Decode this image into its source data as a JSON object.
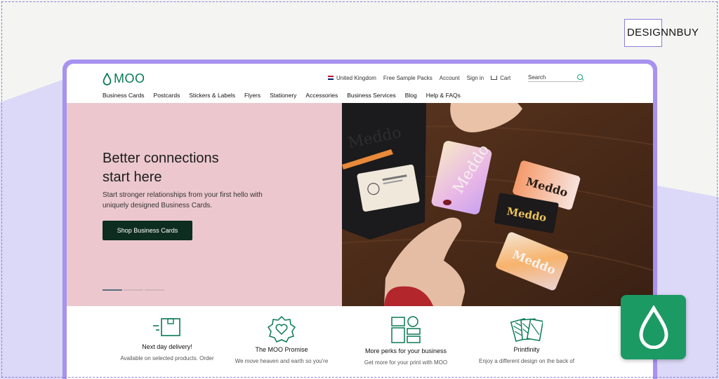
{
  "brand_badge": {
    "text": "DESIGNNBUY"
  },
  "site": {
    "logo_text": "MOO",
    "utility": {
      "region": "United Kingdom",
      "sample_packs": "Free Sample Packs",
      "account": "Account",
      "sign_in": "Sign in",
      "cart": "Cart",
      "search_label": "Search"
    },
    "nav": [
      "Business Cards",
      "Postcards",
      "Stickers & Labels",
      "Flyers",
      "Stationery",
      "Accessories",
      "Business Services",
      "Blog",
      "Help & FAQs"
    ],
    "hero": {
      "title_line1": "Better connections",
      "title_line2": "start here",
      "subtitle": "Start stronger relationships from your first hello with uniquely designed Business Cards.",
      "cta": "Shop Business Cards",
      "slide_active": 1,
      "slide_count": 3,
      "card_text": "Meddo"
    },
    "features": [
      {
        "title": "Next day delivery!",
        "desc": "Available on selected products. Order",
        "icon": "delivery-box-icon"
      },
      {
        "title": "The MOO Promise",
        "desc": "We move heaven and earth so you're",
        "icon": "heart-badge-icon"
      },
      {
        "title": "More perks for your business",
        "desc": "Get more for your print with MOO",
        "icon": "shapes-grid-icon"
      },
      {
        "title": "Printfinity",
        "desc": "Enjoy a different design on the back of",
        "icon": "stacked-cards-icon"
      }
    ]
  },
  "colors": {
    "moo_green": "#0a7a55",
    "hero_pink": "#ecc8ce",
    "cta_dark": "#0e2d21",
    "browser_frame": "#a792f0",
    "app_icon": "#1b9a63"
  }
}
